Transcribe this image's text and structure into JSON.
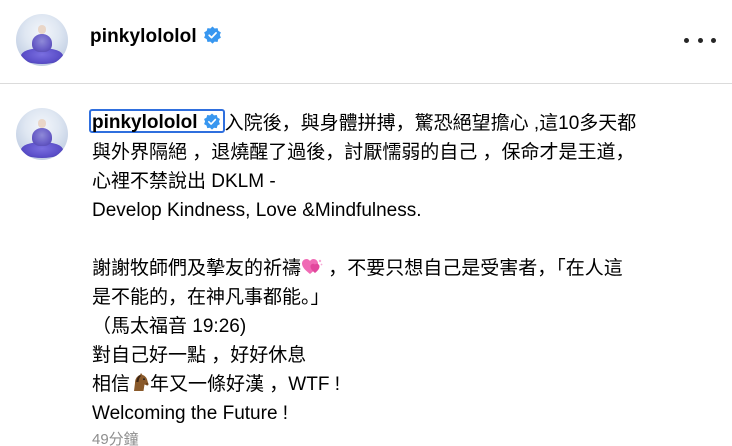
{
  "post": {
    "username": "pinkylololol",
    "verified_icon": "verified-badge-icon",
    "more_icon": "more-options-icon"
  },
  "caption": {
    "username": "pinkylololol",
    "lines": [
      "入院後，與身體拼搏，驚恐絕望擔心 ,這10多天都",
      "與外界隔絕 ，退燒醒了過後，討厭懦弱的自己 ，保命才是王道，",
      "心裡不禁說出 DKLM -",
      "Develop Kindness, Love &Mindfulness.",
      "",
      "謝謝牧師們及摯友的祈禱",
      " ，不要只想自己是受害者，「在人這",
      "是不能的，在神凡事都能。」",
      "（馬太福音 19:26)",
      "對自己好一點 ，好好休息",
      "相信",
      "年又一條好漢 ，WTF !",
      "Welcoming the Future !"
    ],
    "emoji_heart": "heart-emoji-icon",
    "emoji_horse": "horse-emoji-icon"
  },
  "timestamp": "49分鐘",
  "colors": {
    "verified_blue": "#3897f0",
    "highlight_border": "#2f6fde",
    "timestamp_gray": "#8e8e8e",
    "divider": "#dbdbdb"
  }
}
